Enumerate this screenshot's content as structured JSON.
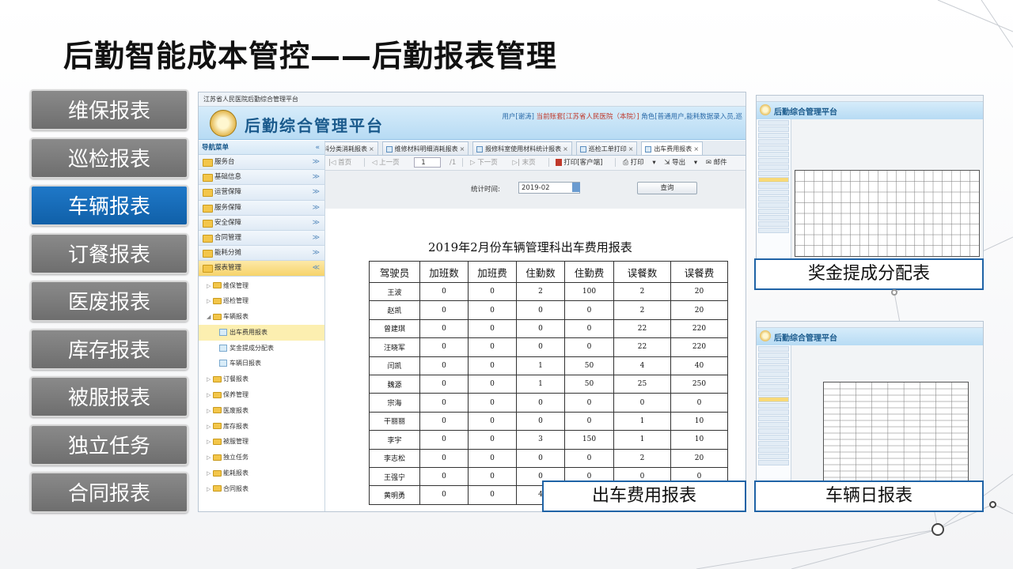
{
  "page_title": "后勤智能成本管控——后勤报表管理",
  "left_menu": [
    {
      "label": "维保报表",
      "active": false
    },
    {
      "label": "巡检报表",
      "active": false
    },
    {
      "label": "车辆报表",
      "active": true
    },
    {
      "label": "订餐报表",
      "active": false
    },
    {
      "label": "医废报表",
      "active": false
    },
    {
      "label": "库存报表",
      "active": false
    },
    {
      "label": "被服报表",
      "active": false
    },
    {
      "label": "独立任务",
      "active": false
    },
    {
      "label": "合同报表",
      "active": false
    }
  ],
  "app": {
    "window_title": "江苏省人民医院后勤综合管理平台",
    "header_title": "后勤综合管理平台",
    "user_link": "用户[谢涛]",
    "current_account": "当前账套[江苏省人民医院（本院）]",
    "role": "角色[普通用户,能耗数据录入员,巡",
    "sidebar": {
      "header": "导航菜单",
      "collapse_icon": "«",
      "sections": [
        "服务台",
        "基础信息",
        "运营保障",
        "服务保障",
        "安全保障",
        "合同管理",
        "能耗分摊"
      ],
      "open_section": "报表管理",
      "tree": [
        {
          "label": "维保管理",
          "level": 1,
          "type": "folder"
        },
        {
          "label": "巡检管理",
          "level": 1,
          "type": "folder"
        },
        {
          "label": "车辆报表",
          "level": 1,
          "type": "folder",
          "expanded": true
        },
        {
          "label": "出车费用报表",
          "level": 2,
          "type": "leaf",
          "selected": true
        },
        {
          "label": "奖金提成分配表",
          "level": 2,
          "type": "leaf"
        },
        {
          "label": "车辆日报表",
          "level": 2,
          "type": "leaf"
        },
        {
          "label": "订餐报表",
          "level": 1,
          "type": "folder"
        },
        {
          "label": "保养管理",
          "level": 1,
          "type": "folder"
        },
        {
          "label": "医废报表",
          "level": 1,
          "type": "folder"
        },
        {
          "label": "库存报表",
          "level": 1,
          "type": "folder"
        },
        {
          "label": "被服管理",
          "level": 1,
          "type": "folder"
        },
        {
          "label": "独立任务",
          "level": 1,
          "type": "folder"
        },
        {
          "label": "能耗报表",
          "level": 1,
          "type": "folder"
        },
        {
          "label": "合同报表",
          "level": 1,
          "type": "folder"
        }
      ]
    },
    "tabs": [
      {
        "label": "科分类消耗报表",
        "active": false
      },
      {
        "label": "维修材料明细消耗报表",
        "active": false
      },
      {
        "label": "报修科室使用材料统计报表",
        "active": false
      },
      {
        "label": "巡检工单打印",
        "active": false
      },
      {
        "label": "出车费用报表",
        "active": true
      }
    ],
    "toolbar": {
      "first": "首页",
      "prev": "上一页",
      "page": "1",
      "total": "/1",
      "next": "下一页",
      "last": "末页",
      "print_client": "打印[客户端]",
      "print": "打印",
      "export": "导出",
      "mail": "邮件"
    },
    "filter": {
      "label": "统计时间:",
      "value": "2019-02",
      "query_button": "查询"
    },
    "report": {
      "title": "2019年2月份车辆管理科出车费用报表",
      "columns": [
        "驾驶员",
        "加班数",
        "加班费",
        "住勤数",
        "住勤费",
        "误餐数",
        "误餐费"
      ],
      "rows": [
        [
          "王波",
          "0",
          "0",
          "2",
          "100",
          "2",
          "20"
        ],
        [
          "赵凯",
          "0",
          "0",
          "0",
          "0",
          "2",
          "20"
        ],
        [
          "曾建琪",
          "0",
          "0",
          "0",
          "0",
          "22",
          "220"
        ],
        [
          "汪晓军",
          "0",
          "0",
          "0",
          "0",
          "22",
          "220"
        ],
        [
          "闫凯",
          "0",
          "0",
          "1",
          "50",
          "4",
          "40"
        ],
        [
          "魏源",
          "0",
          "0",
          "1",
          "50",
          "25",
          "250"
        ],
        [
          "宗海",
          "0",
          "0",
          "0",
          "0",
          "0",
          "0"
        ],
        [
          "干丽丽",
          "0",
          "0",
          "0",
          "0",
          "1",
          "10"
        ],
        [
          "李宇",
          "0",
          "0",
          "3",
          "150",
          "1",
          "10"
        ],
        [
          "李志松",
          "0",
          "0",
          "0",
          "0",
          "2",
          "20"
        ],
        [
          "王强宁",
          "0",
          "0",
          "0",
          "0",
          "0",
          "0"
        ],
        [
          "黄明勇",
          "0",
          "0",
          "4",
          "",
          "",
          ""
        ]
      ]
    }
  },
  "thumbnails": [
    {
      "header_title": "后勤综合管理平台",
      "caption": "奖金提成分配表"
    },
    {
      "header_title": "后勤综合管理平台",
      "caption": "车辆日报表"
    }
  ],
  "main_caption": "出车费用报表"
}
